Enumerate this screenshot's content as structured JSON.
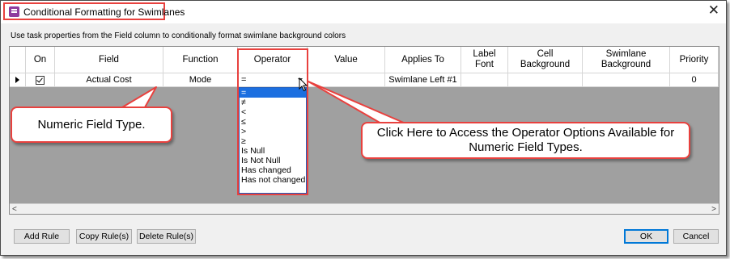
{
  "window": {
    "title": "Conditional Formatting for Swimlanes",
    "close_glyph": "✕"
  },
  "instruction": "Use task properties from the Field column to conditionally format swimlane background colors",
  "columns": [
    "On",
    "Field",
    "Function",
    "Operator",
    "Value",
    "Applies To",
    "Label Font",
    "Cell Background",
    "Swimlane Background",
    "Priority"
  ],
  "row": {
    "on": true,
    "field": "Actual Cost",
    "function": "Mode",
    "operator": "=",
    "value": "",
    "applies_to": "Swimlane Left #1",
    "label_font": "",
    "cell_background": "",
    "swimlane_background": "",
    "priority": "0"
  },
  "operator_options": [
    "=",
    "≠",
    "<",
    "≤",
    ">",
    "≥",
    "Is Null",
    "Is Not Null",
    "Has changed",
    "Has not changed"
  ],
  "callouts": {
    "left": "Numeric Field Type.",
    "right": "Click Here to Access the Operator Options Available for Numeric Field Types."
  },
  "buttons": {
    "add_rule": "Add Rule",
    "copy_rules": "Copy Rule(s)",
    "delete_rules": "Delete Rule(s)",
    "ok": "OK",
    "cancel": "Cancel"
  },
  "scroll": {
    "left": "<",
    "right": ">"
  },
  "colors": {
    "highlight": "#e8413e",
    "selection": "#1c6fe0",
    "grid_background": "#a0a0a0"
  }
}
